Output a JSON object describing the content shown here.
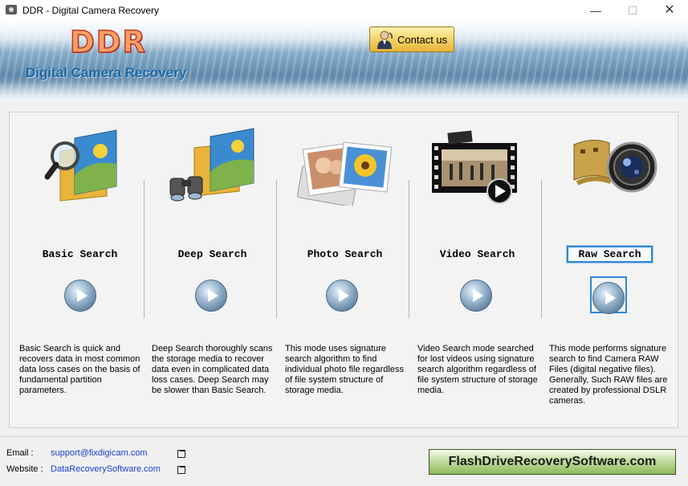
{
  "window": {
    "title": "DDR - Digital Camera Recovery"
  },
  "header": {
    "logo": "DDR",
    "subtitle": "Digital Camera Recovery",
    "contact_label": "Contact us"
  },
  "modes": [
    {
      "label": "Basic Search",
      "icon": "folder-search-icon",
      "description": "Basic Search is quick and recovers data in most common data loss cases on the basis of fundamental partition parameters."
    },
    {
      "label": "Deep Search",
      "icon": "binoculars-folder-icon",
      "description": "Deep Search thoroughly scans the storage media to recover data even in complicated data loss cases. Deep Search may be slower than Basic Search."
    },
    {
      "label": "Photo Search",
      "icon": "photos-icon",
      "description": "This mode uses signature search algorithm to find individual photo file regardless of file system structure of storage media."
    },
    {
      "label": "Video Search",
      "icon": "film-strip-icon",
      "description": "Video Search mode searched for lost videos using signature search algorithm regardless of file system structure of storage media."
    },
    {
      "label": "Raw Search",
      "icon": "camera-lens-icon",
      "selected": true,
      "description": "This mode performs signature search to find Camera RAW Files (digital negative files). Generally, Such RAW files are created by professional DSLR cameras."
    }
  ],
  "footer": {
    "email_label": "Email :",
    "email": "support@fixdigicam.com",
    "website_label": "Website :",
    "website": "DataRecoverySoftware.com",
    "brand": "FlashDriveRecoverySoftware.com"
  },
  "colors": {
    "accent": "#2f86d6",
    "logo": "#f6a063",
    "link": "#1a3fd1"
  }
}
